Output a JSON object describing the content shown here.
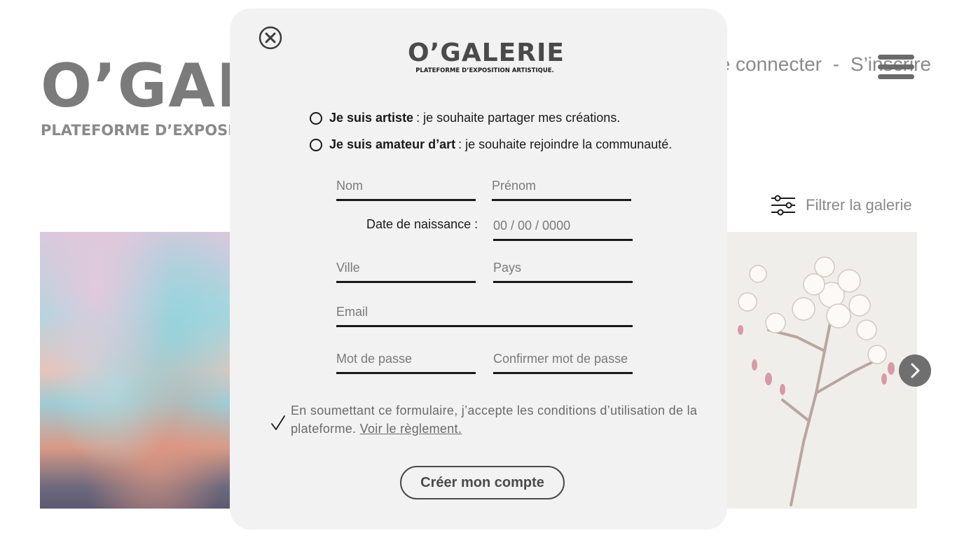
{
  "background": {
    "logo_title": "O’GALERIE",
    "logo_subtitle": "PLATEFORME D’EXPOSITION ARTISTIQUE.",
    "nav": {
      "connect": "Se connecter",
      "separator": "-",
      "signup": "S’inscrire"
    },
    "filter_label": "Filtrer la galerie",
    "menu_icon": "hamburger-icon",
    "filter_icon": "sliders-icon",
    "next_icon": "chevron-right-icon"
  },
  "modal": {
    "close_icon": "close-circle-icon",
    "logo_title": "O’GALERIE",
    "logo_subtitle": "PLATEFORME D’EXPOSITION ARTISTIQUE.",
    "roles": [
      {
        "title": "Je suis artiste",
        "text": ": je souhaite partager mes créations."
      },
      {
        "title": "Je suis amateur d’art",
        "text": ": je souhaite rejoindre la communauté."
      }
    ],
    "fields": {
      "nom": "Nom",
      "prenom": "Prénom",
      "dob_label": "Date de naissance :",
      "dob_placeholder": "00 / 00 / 0000",
      "ville": "Ville",
      "pays": "Pays",
      "email": "Email",
      "password": "Mot de passe",
      "confirm_password": "Confirmer mot de passe"
    },
    "terms_text": "En soumettant ce formulaire, j’accepte les conditions d’utilisation de la plateforme.",
    "terms_link": "Voir le règlement.",
    "submit_label": "Créer mon compte"
  },
  "colors": {
    "modal_bg": "#f2f2f2",
    "text_dark": "#1a1a1a",
    "muted": "#7a7a7a"
  }
}
